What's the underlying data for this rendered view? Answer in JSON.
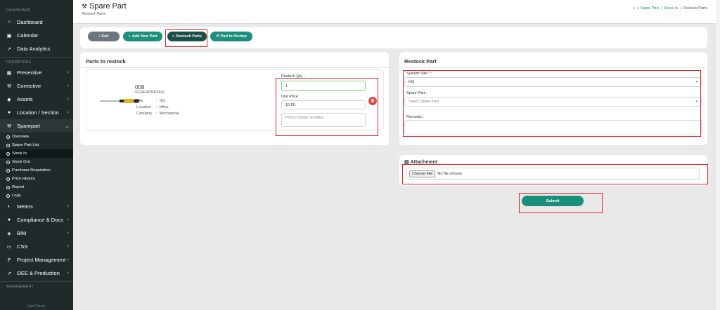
{
  "sidebar": {
    "sections": {
      "dashboard": "DASHBOARD",
      "operations": "OPERATIONS",
      "management": "MANAGEMENT"
    },
    "top_items": [
      {
        "label": "Dashboard",
        "icon": "home-icon"
      },
      {
        "label": "Calendar",
        "icon": "calendar-icon"
      },
      {
        "label": "Data Analytics",
        "icon": "chart-line-icon"
      }
    ],
    "ops_items": [
      {
        "label": "Preventive",
        "icon": "calendar-check-icon"
      },
      {
        "label": "Corrective",
        "icon": "wrench-icon"
      },
      {
        "label": "Assets",
        "icon": "tag-icon"
      },
      {
        "label": "Location / Section",
        "icon": "map-pin-icon"
      },
      {
        "label": "Sparepart",
        "icon": "tools-icon"
      }
    ],
    "sparepart_sub": [
      "Overview",
      "Spare Part List",
      "Stock In",
      "Stock Out",
      "Purchase Requisition",
      "Price History",
      "Report",
      "Logs"
    ],
    "bottom_items": [
      {
        "label": "Meters",
        "icon": "gauge-icon"
      },
      {
        "label": "Compliance & Docs",
        "icon": "shield-icon"
      },
      {
        "label": "BIM",
        "icon": "cube-icon"
      },
      {
        "label": "CSS",
        "icon": "monitor-icon"
      },
      {
        "label": "Project Management",
        "icon": "project-icon"
      },
      {
        "label": "OEE & Production",
        "icon": "chart-line-icon"
      }
    ],
    "footer": "EnVCloud+"
  },
  "header": {
    "title": "Spare Part",
    "subtitle": "Restock Parts",
    "breadcrumb": [
      "Spare Part",
      "Stock In",
      "Restock Parts"
    ]
  },
  "toolbar": {
    "exit": "Exit",
    "add_new_part": "Add New Part",
    "restock_parts": "Restock Parts",
    "part_in_history": "Part In History"
  },
  "parts_card": {
    "title": "Parts to restock",
    "item": {
      "code": "008",
      "name": "SCREWDRIVER",
      "site_label": "Site",
      "site_value": "HQ",
      "location_label": "Location",
      "location_value": "office",
      "category_label": "Category",
      "category_value": "Mechanical",
      "restock_qty_label": "Restock Qty :",
      "restock_qty_value": "1",
      "unit_price_label": "Unit Price :",
      "unit_price_value": "10.50",
      "remarks_placeholder": "Price change remarks."
    }
  },
  "restock_card": {
    "title": "Restock Part",
    "system_site_label": "System Site * :",
    "system_site_value": "HQ",
    "spare_part_label": "Spare Part :",
    "spare_part_placeholder": "Select Spare Part",
    "remarks_label": "Remarks :"
  },
  "attachment": {
    "title": "Attachment",
    "choose_file": "Choose File",
    "no_file": "No file chosen"
  },
  "submit": "Submit",
  "colors": {
    "sidebar_bg": "#1f2a2a",
    "primary": "#1b8f7b",
    "primary_dark": "#1c4e47",
    "danger": "#d94a4a",
    "highlight": "#d9252a"
  }
}
